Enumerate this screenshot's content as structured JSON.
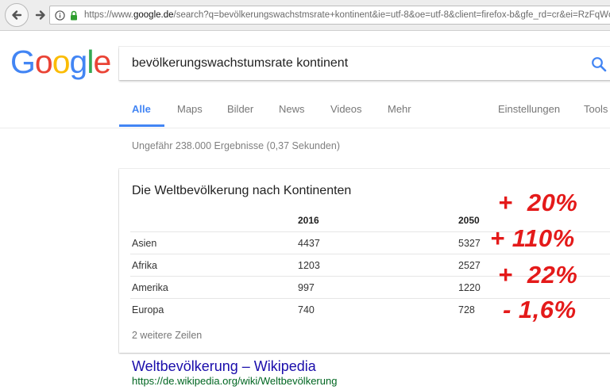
{
  "browser": {
    "url_prefix": "https://www.",
    "url_domain": "google.de",
    "url_rest": "/search?q=bevölkerungswachstmsrate+kontinent&ie=utf-8&oe=utf-8&client=firefox-b&gfe_rd=cr&ei=RzFqWcS"
  },
  "logo": {
    "letters": [
      "G",
      "o",
      "o",
      "g",
      "l",
      "e"
    ],
    "colors": [
      "#4285F4",
      "#EA4335",
      "#FBBC05",
      "#4285F4",
      "#34A853",
      "#EA4335"
    ]
  },
  "search": {
    "query": "bevölkerungswachstumsrate kontinent"
  },
  "tabs": {
    "items": [
      "Alle",
      "Maps",
      "Bilder",
      "News",
      "Videos",
      "Mehr"
    ],
    "settings": "Einstellungen",
    "tools": "Tools"
  },
  "stats": "Ungefähr 238.000 Ergebnisse (0,37 Sekunden)",
  "card": {
    "title": "Die Weltbevölkerung nach Kontinenten",
    "columns": [
      "2016",
      "2050"
    ],
    "rows": [
      {
        "name": "Asien",
        "v2016": "4437",
        "v2050": "5327"
      },
      {
        "name": "Afrika",
        "v2016": "1203",
        "v2050": "2527"
      },
      {
        "name": "Amerika",
        "v2016": "997",
        "v2050": "1220"
      },
      {
        "name": "Europa",
        "v2016": "740",
        "v2050": "728"
      }
    ],
    "more": "2 weitere Zeilen"
  },
  "wiki": {
    "title": "Weltbevölkerung – Wikipedia",
    "url": "https://de.wikipedia.org/wiki/Weltbevölkerung"
  },
  "annotations": [
    "+  20%",
    "+ 110%",
    "+  22%",
    "- 1,6%"
  ],
  "colors": {
    "accent": "#4285f4",
    "annotation": "#e41a1a",
    "link": "#1a0dab",
    "url_green": "#006621"
  }
}
